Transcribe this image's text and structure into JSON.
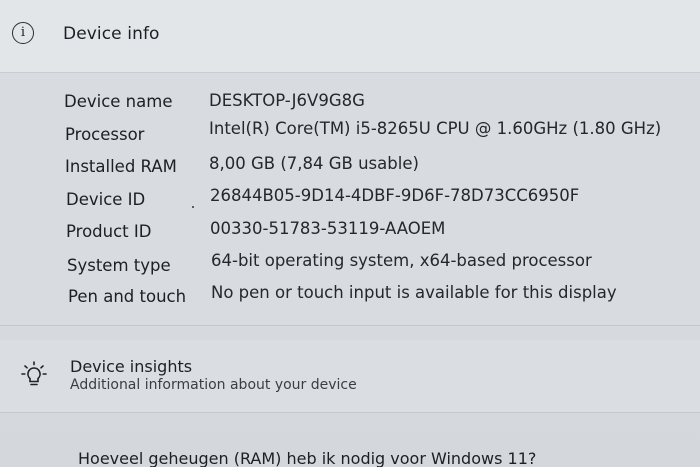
{
  "header": {
    "icon": "info-icon",
    "icon_glyph": "i",
    "title": "Device info"
  },
  "specs": [
    {
      "label": "Device name",
      "value": "DESKTOP-J6V9G8G"
    },
    {
      "label": "Processor",
      "value": "Intel(R) Core(TM) i5-8265U CPU @ 1.60GHz   (1.80 GHz)"
    },
    {
      "label": "Installed RAM",
      "value": "8,00 GB (7,84 GB usable)"
    },
    {
      "label": "Device ID",
      "value": "26844B05-9D14-4DBF-9D6F-78D73CC6950F"
    },
    {
      "label": "Product ID",
      "value": "00330-51783-53119-AAOEM"
    },
    {
      "label": "System type",
      "value": "64-bit operating system, x64-based processor"
    },
    {
      "label": "Pen and touch",
      "value": "No pen or touch input is available for this display"
    }
  ],
  "insights": {
    "icon": "lightbulb-icon",
    "title": "Device insights",
    "subtitle": "Additional information about your device"
  },
  "help_link": "Hoeveel geheugen (RAM) heb ik nodig voor Windows 11?"
}
